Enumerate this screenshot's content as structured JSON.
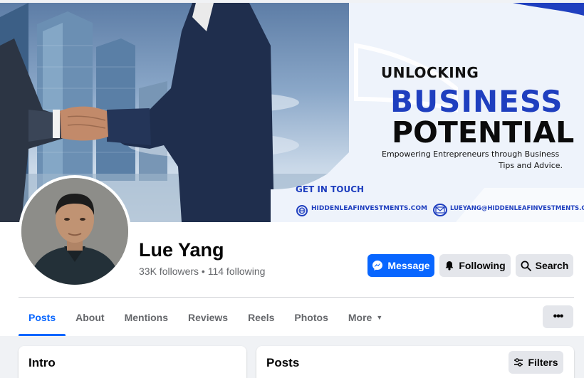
{
  "cover": {
    "headline_small": "UNLOCKING",
    "headline_blue": "BUSINESS",
    "headline_big": "POTENTIAL",
    "tagline_line1": "Empowering Entrepreneurs through Business",
    "tagline_line2": "Tips and Advice.",
    "get_in_touch": "GET IN TOUCH",
    "website": "HIDDENLEAFINVESTMENTS.COM",
    "email": "LUEYANG@HIDDENLEAFINVESTMENTS.COM",
    "brand_color": "#1f3fbf"
  },
  "profile": {
    "name": "Lue Yang",
    "stats": "33K followers • 114 following"
  },
  "actions": {
    "message_label": "Message",
    "following_label": "Following",
    "search_label": "Search",
    "more_label": "•••"
  },
  "tabs": [
    {
      "label": "Posts",
      "active": true
    },
    {
      "label": "About"
    },
    {
      "label": "Mentions"
    },
    {
      "label": "Reviews"
    },
    {
      "label": "Reels"
    },
    {
      "label": "Photos"
    },
    {
      "label": "More",
      "caret": "▼"
    }
  ],
  "cards": {
    "intro_title": "Intro",
    "posts_title": "Posts",
    "filters_label": "Filters"
  },
  "colors": {
    "accent": "#0866ff",
    "secondary_button": "#e4e6eb",
    "muted_text": "#65676b"
  }
}
